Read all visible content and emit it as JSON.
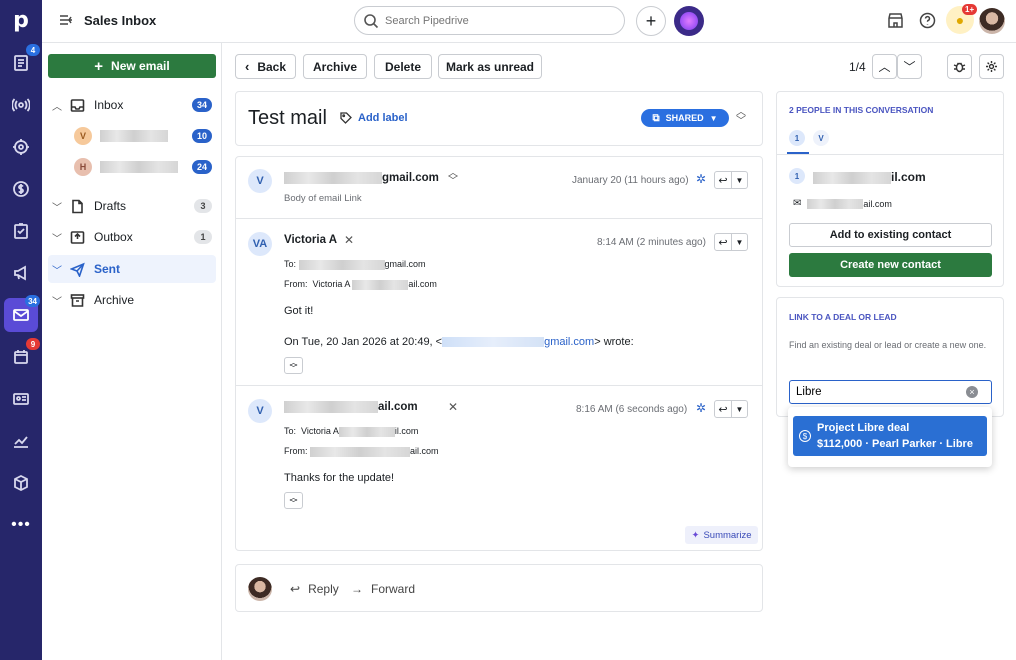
{
  "app": {
    "title": "Sales Inbox",
    "search_placeholder": "Search Pipedrive",
    "notif_badge": "1+"
  },
  "rail": {
    "badges": {
      "mail": "34",
      "calendar": "9",
      "deals": "4"
    }
  },
  "sidebar": {
    "new_email": "New email",
    "folders": [
      {
        "label": "Inbox",
        "count": "34"
      },
      {
        "label": "Drafts",
        "count": "3"
      },
      {
        "label": "Outbox",
        "count": "1"
      },
      {
        "label": "Sent",
        "count": ""
      },
      {
        "label": "Archive",
        "count": ""
      }
    ],
    "inbox_sub": [
      {
        "initial": "V",
        "count": "10"
      },
      {
        "initial": "H",
        "count": "24"
      }
    ]
  },
  "toolbar": {
    "back": "Back",
    "archive": "Archive",
    "delete": "Delete",
    "mark_unread": "Mark as unread",
    "pager": "1/4"
  },
  "thread": {
    "subject": "Test mail",
    "add_label": "Add label",
    "shared": "SHARED",
    "messages": [
      {
        "avatar": "V",
        "from_suffix": "gmail.com",
        "date": "January 20 (11 hours ago)",
        "preview": "Body of email Link"
      },
      {
        "avatar": "VA",
        "from": "Victoria A",
        "date": "8:14 AM (2 minutes ago)",
        "to_label": "To:",
        "to_suffix": "gmail.com",
        "from_label": "From:",
        "from_name": "Victoria A",
        "from_suffix": "ail.com",
        "body": "Got it!",
        "quote_prefix": "On Tue, 20 Jan 2026 at 20:49, <",
        "quote_link": "gmail.com",
        "quote_suffix": "> wrote:"
      },
      {
        "avatar": "V",
        "from_suffix": "ail.com",
        "date": "8:16 AM (6 seconds ago)",
        "to_label": "To:",
        "to_name": "Victoria A",
        "to_suffix": "il.com",
        "from_label": "From:",
        "body": "Thanks for the update!",
        "summarize": "Summarize"
      }
    ],
    "reply": "Reply",
    "forward": "Forward"
  },
  "right": {
    "people_title": "2 PEOPLE IN THIS CONVERSATION",
    "people_tabs": [
      "1",
      "V"
    ],
    "person": {
      "index": "1",
      "name_suffix": "il.com",
      "email_suffix": "ail.com"
    },
    "add_existing": "Add to existing contact",
    "create_new": "Create new contact",
    "link_title": "LINK TO A DEAL OR LEAD",
    "link_desc": "Find an existing deal or lead or create a new one.",
    "search_value": "Libre",
    "result": {
      "title": "Project Libre deal",
      "subtitle": "$112,000 · Pearl Parker · Libre"
    }
  },
  "colors": {
    "brand_green": "#2c7a3f",
    "rail": "#26266a",
    "accent_blue": "#2a62c9",
    "shared_blue": "#2a6fe0",
    "result_blue": "#2a6fd3",
    "badge_red": "#e53935"
  }
}
